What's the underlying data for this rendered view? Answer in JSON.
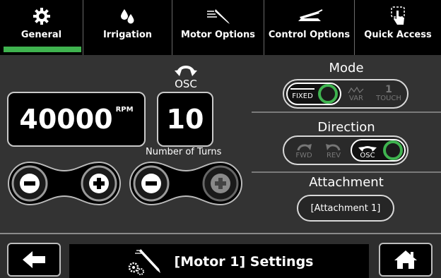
{
  "tabs": [
    {
      "label": "General",
      "icon": "gear-icon",
      "active": true
    },
    {
      "label": "Irrigation",
      "icon": "water-drops-icon",
      "active": false
    },
    {
      "label": "Motor Options",
      "icon": "motor-handpiece-icon",
      "active": false
    },
    {
      "label": "Control Options",
      "icon": "foot-pedal-icon",
      "active": false
    },
    {
      "label": "Quick Access",
      "icon": "touch-hand-icon",
      "active": false
    }
  ],
  "speed": {
    "value": "40000",
    "unit": "RPM"
  },
  "osc": {
    "label": "OSC",
    "value": "10",
    "caption": "Number of Turns"
  },
  "mode": {
    "title": "Mode",
    "options": [
      {
        "label": "FIXED",
        "active": true
      },
      {
        "label": "VAR",
        "active": false
      },
      {
        "label": "TOUCH",
        "num": "1",
        "active": false
      }
    ]
  },
  "direction": {
    "title": "Direction",
    "options": [
      {
        "label": "FWD",
        "active": false
      },
      {
        "label": "REV",
        "active": false
      },
      {
        "label": "OSC",
        "active": true
      }
    ]
  },
  "attachment": {
    "title": "Attachment",
    "value": "[Attachment 1]"
  },
  "footer": {
    "title": "[Motor 1] Settings",
    "back_icon": "back-arrow-icon",
    "home_icon": "home-icon"
  },
  "colors": {
    "accent": "#3fb34f",
    "background": "#333333",
    "panel": "#000000"
  }
}
